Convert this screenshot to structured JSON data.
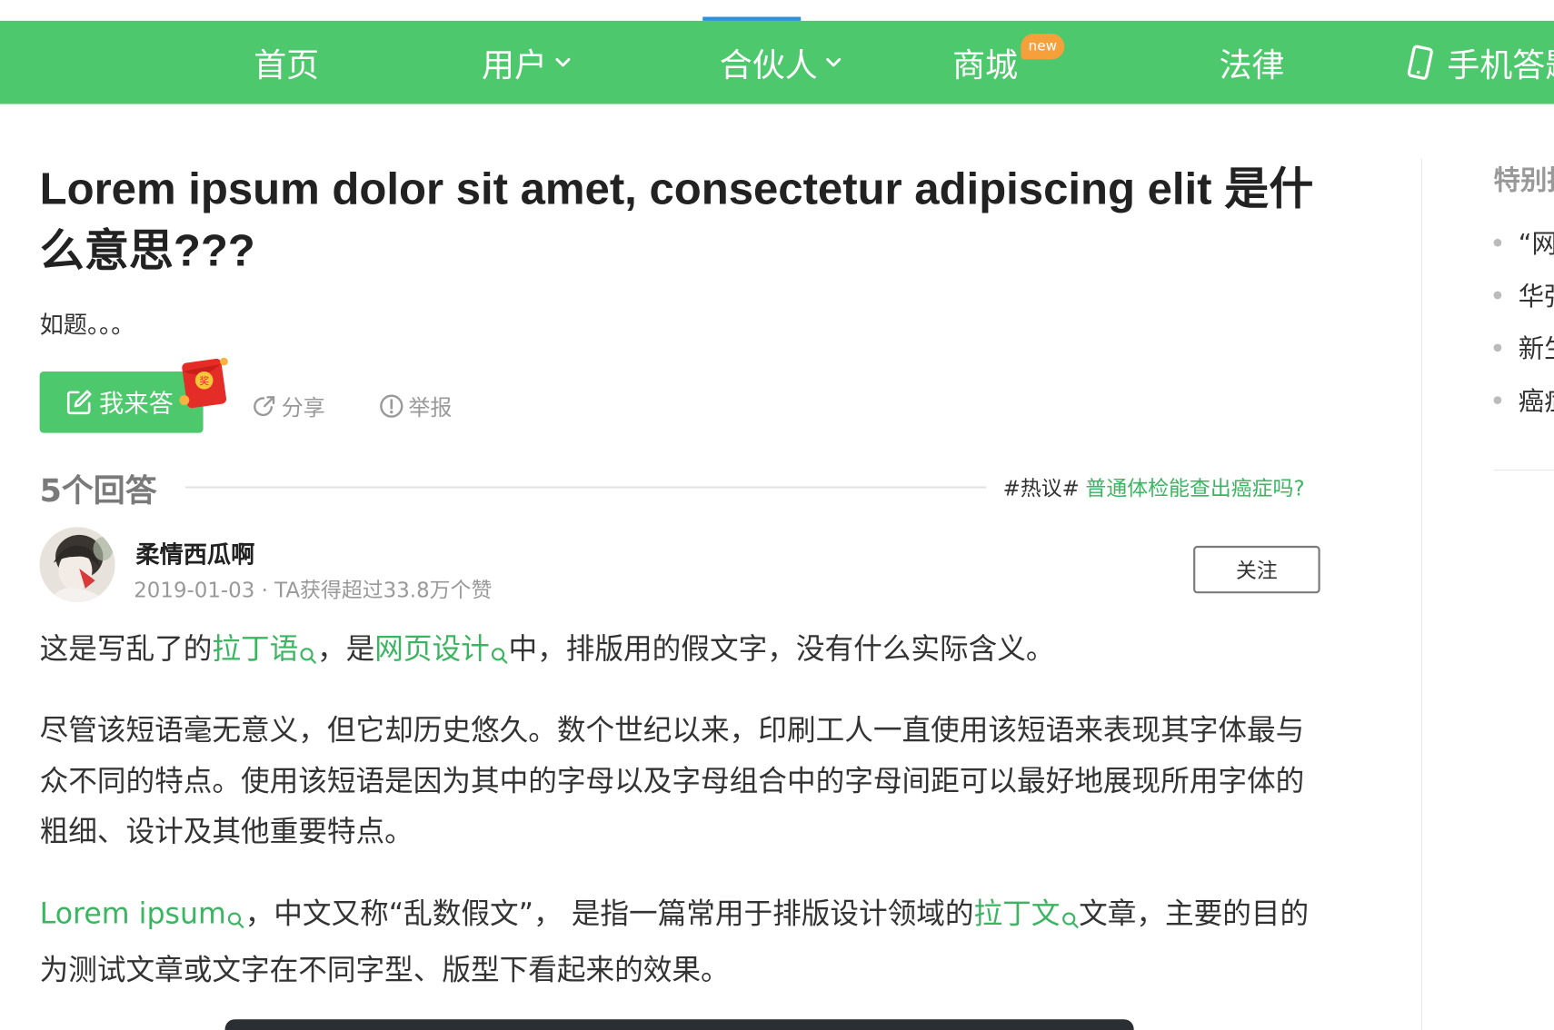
{
  "nav": {
    "items": [
      {
        "label": "首页"
      },
      {
        "label": "用户"
      },
      {
        "label": "合伙人"
      },
      {
        "label": "商城"
      },
      {
        "label": "法律"
      },
      {
        "label": "手机答题"
      }
    ],
    "shop_badge": "new",
    "colors": {
      "bar": "#4ec86c",
      "active_indicator": "#2d8fe0",
      "badge": "#f5a03b"
    }
  },
  "question": {
    "title": "Lorem ipsum dolor sit amet, consectetur adipiscing elit 是什么意思???",
    "description": "如题。。。",
    "answer_button": "我来答",
    "redpack_char": "奖",
    "share": "分享",
    "report": "举报"
  },
  "answers": {
    "count_label": "5个回答",
    "hot_tag": "#热议#",
    "hot_link": "普通体检能查出癌症吗?"
  },
  "answer": {
    "username": "柔情西瓜啊",
    "meta": "2019-01-03 · TA获得超过33.8万个赞",
    "follow": "关注",
    "p1": {
      "t1": "这是写乱了的",
      "k1": "拉丁语",
      "t2": "，是",
      "k2": "网页设计",
      "t3": "中，排版用的假文字，没有什么实际含义。"
    },
    "p2": "尽管该短语毫无意义，但它却历史悠久。数个世纪以来，印刷工人一直使用该短语来表现其字体最与众不同的特点。使用该短语是因为其中的字母以及字母组合中的字母间距可以最好地展现所用字体的粗细、设计及其他重要特点。",
    "p3": {
      "k1": "Lorem ipsum",
      "t1": "，中文又称“乱数假文”， 是指一篇常用于排版设计领域的",
      "k2": "拉丁文",
      "t2": "文章，主要的目的为测试文章或文字在不同字型、版型下看起来的效果。"
    }
  },
  "sidebar": {
    "title": "特别推荐",
    "items": [
      {
        "label": "“网"
      },
      {
        "label": "华强"
      },
      {
        "label": "新生"
      },
      {
        "label": "癌症"
      }
    ]
  }
}
